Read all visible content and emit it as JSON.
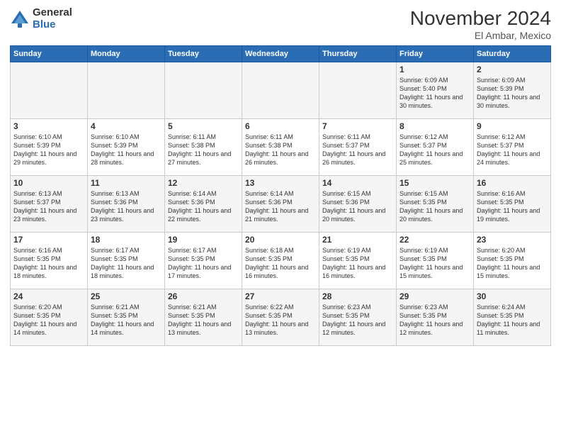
{
  "logo": {
    "general": "General",
    "blue": "Blue"
  },
  "title": {
    "month": "November 2024",
    "location": "El Ambar, Mexico"
  },
  "days_header": [
    "Sunday",
    "Monday",
    "Tuesday",
    "Wednesday",
    "Thursday",
    "Friday",
    "Saturday"
  ],
  "weeks": [
    [
      {
        "day": "",
        "info": ""
      },
      {
        "day": "",
        "info": ""
      },
      {
        "day": "",
        "info": ""
      },
      {
        "day": "",
        "info": ""
      },
      {
        "day": "",
        "info": ""
      },
      {
        "day": "1",
        "info": "Sunrise: 6:09 AM\nSunset: 5:40 PM\nDaylight: 11 hours and 30 minutes."
      },
      {
        "day": "2",
        "info": "Sunrise: 6:09 AM\nSunset: 5:39 PM\nDaylight: 11 hours and 30 minutes."
      }
    ],
    [
      {
        "day": "3",
        "info": "Sunrise: 6:10 AM\nSunset: 5:39 PM\nDaylight: 11 hours and 29 minutes."
      },
      {
        "day": "4",
        "info": "Sunrise: 6:10 AM\nSunset: 5:39 PM\nDaylight: 11 hours and 28 minutes."
      },
      {
        "day": "5",
        "info": "Sunrise: 6:11 AM\nSunset: 5:38 PM\nDaylight: 11 hours and 27 minutes."
      },
      {
        "day": "6",
        "info": "Sunrise: 6:11 AM\nSunset: 5:38 PM\nDaylight: 11 hours and 26 minutes."
      },
      {
        "day": "7",
        "info": "Sunrise: 6:11 AM\nSunset: 5:37 PM\nDaylight: 11 hours and 26 minutes."
      },
      {
        "day": "8",
        "info": "Sunrise: 6:12 AM\nSunset: 5:37 PM\nDaylight: 11 hours and 25 minutes."
      },
      {
        "day": "9",
        "info": "Sunrise: 6:12 AM\nSunset: 5:37 PM\nDaylight: 11 hours and 24 minutes."
      }
    ],
    [
      {
        "day": "10",
        "info": "Sunrise: 6:13 AM\nSunset: 5:37 PM\nDaylight: 11 hours and 23 minutes."
      },
      {
        "day": "11",
        "info": "Sunrise: 6:13 AM\nSunset: 5:36 PM\nDaylight: 11 hours and 23 minutes."
      },
      {
        "day": "12",
        "info": "Sunrise: 6:14 AM\nSunset: 5:36 PM\nDaylight: 11 hours and 22 minutes."
      },
      {
        "day": "13",
        "info": "Sunrise: 6:14 AM\nSunset: 5:36 PM\nDaylight: 11 hours and 21 minutes."
      },
      {
        "day": "14",
        "info": "Sunrise: 6:15 AM\nSunset: 5:36 PM\nDaylight: 11 hours and 20 minutes."
      },
      {
        "day": "15",
        "info": "Sunrise: 6:15 AM\nSunset: 5:35 PM\nDaylight: 11 hours and 20 minutes."
      },
      {
        "day": "16",
        "info": "Sunrise: 6:16 AM\nSunset: 5:35 PM\nDaylight: 11 hours and 19 minutes."
      }
    ],
    [
      {
        "day": "17",
        "info": "Sunrise: 6:16 AM\nSunset: 5:35 PM\nDaylight: 11 hours and 18 minutes."
      },
      {
        "day": "18",
        "info": "Sunrise: 6:17 AM\nSunset: 5:35 PM\nDaylight: 11 hours and 18 minutes."
      },
      {
        "day": "19",
        "info": "Sunrise: 6:17 AM\nSunset: 5:35 PM\nDaylight: 11 hours and 17 minutes."
      },
      {
        "day": "20",
        "info": "Sunrise: 6:18 AM\nSunset: 5:35 PM\nDaylight: 11 hours and 16 minutes."
      },
      {
        "day": "21",
        "info": "Sunrise: 6:19 AM\nSunset: 5:35 PM\nDaylight: 11 hours and 16 minutes."
      },
      {
        "day": "22",
        "info": "Sunrise: 6:19 AM\nSunset: 5:35 PM\nDaylight: 11 hours and 15 minutes."
      },
      {
        "day": "23",
        "info": "Sunrise: 6:20 AM\nSunset: 5:35 PM\nDaylight: 11 hours and 15 minutes."
      }
    ],
    [
      {
        "day": "24",
        "info": "Sunrise: 6:20 AM\nSunset: 5:35 PM\nDaylight: 11 hours and 14 minutes."
      },
      {
        "day": "25",
        "info": "Sunrise: 6:21 AM\nSunset: 5:35 PM\nDaylight: 11 hours and 14 minutes."
      },
      {
        "day": "26",
        "info": "Sunrise: 6:21 AM\nSunset: 5:35 PM\nDaylight: 11 hours and 13 minutes."
      },
      {
        "day": "27",
        "info": "Sunrise: 6:22 AM\nSunset: 5:35 PM\nDaylight: 11 hours and 13 minutes."
      },
      {
        "day": "28",
        "info": "Sunrise: 6:23 AM\nSunset: 5:35 PM\nDaylight: 11 hours and 12 minutes."
      },
      {
        "day": "29",
        "info": "Sunrise: 6:23 AM\nSunset: 5:35 PM\nDaylight: 11 hours and 12 minutes."
      },
      {
        "day": "30",
        "info": "Sunrise: 6:24 AM\nSunset: 5:35 PM\nDaylight: 11 hours and 11 minutes."
      }
    ]
  ]
}
